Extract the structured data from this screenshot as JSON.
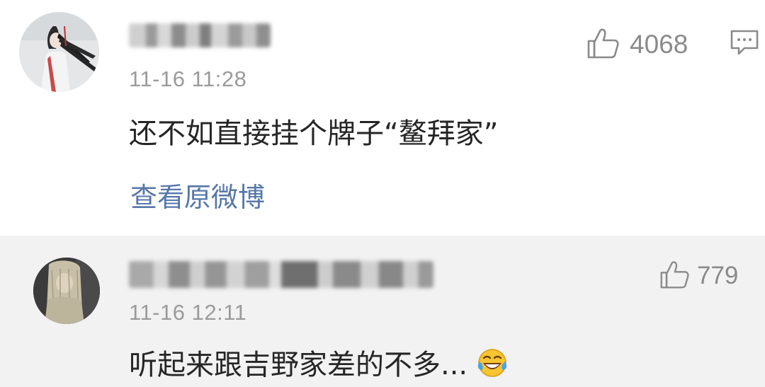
{
  "comments": [
    {
      "timestamp": "11-16 11:28",
      "text": "还不如直接挂个牌子“鳌拜家”",
      "likes": "4068",
      "action_link": "查看原微博"
    },
    {
      "timestamp": "11-16 12:11",
      "text": "听起来跟吉野家差的不多...",
      "likes": "779",
      "emoji": "laugh-cry-emoji"
    }
  ],
  "icons": {
    "like": "thumbs-up-icon",
    "reply": "comment-bubble-icon"
  },
  "colors": {
    "link": "#5677a9",
    "text": "#262626",
    "meta": "#9b9b9b",
    "reply_bg": "#f2f2f2"
  }
}
